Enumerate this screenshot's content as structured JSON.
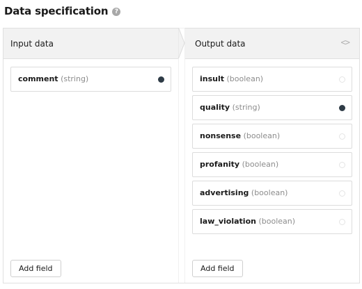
{
  "header": {
    "title": "Data specification",
    "help_glyph": "?"
  },
  "input_panel": {
    "title": "Input data",
    "fields": [
      {
        "name": "comment",
        "type": "(string)",
        "selected": true
      }
    ],
    "add_label": "Add field"
  },
  "output_panel": {
    "title": "Output data",
    "code_glyph": "<>",
    "fields": [
      {
        "name": "insult",
        "type": "(boolean)",
        "selected": false
      },
      {
        "name": "quality",
        "type": "(string)",
        "selected": true
      },
      {
        "name": "nonsense",
        "type": "(boolean)",
        "selected": false
      },
      {
        "name": "profanity",
        "type": "(boolean)",
        "selected": false
      },
      {
        "name": "advertising",
        "type": "(boolean)",
        "selected": false
      },
      {
        "name": "law_violation",
        "type": "(boolean)",
        "selected": false
      }
    ],
    "add_label": "Add field"
  },
  "colors": {
    "selected_dot": "#2e3b46",
    "header_bg": "#f2f2f2",
    "border": "#e0e0e0"
  }
}
